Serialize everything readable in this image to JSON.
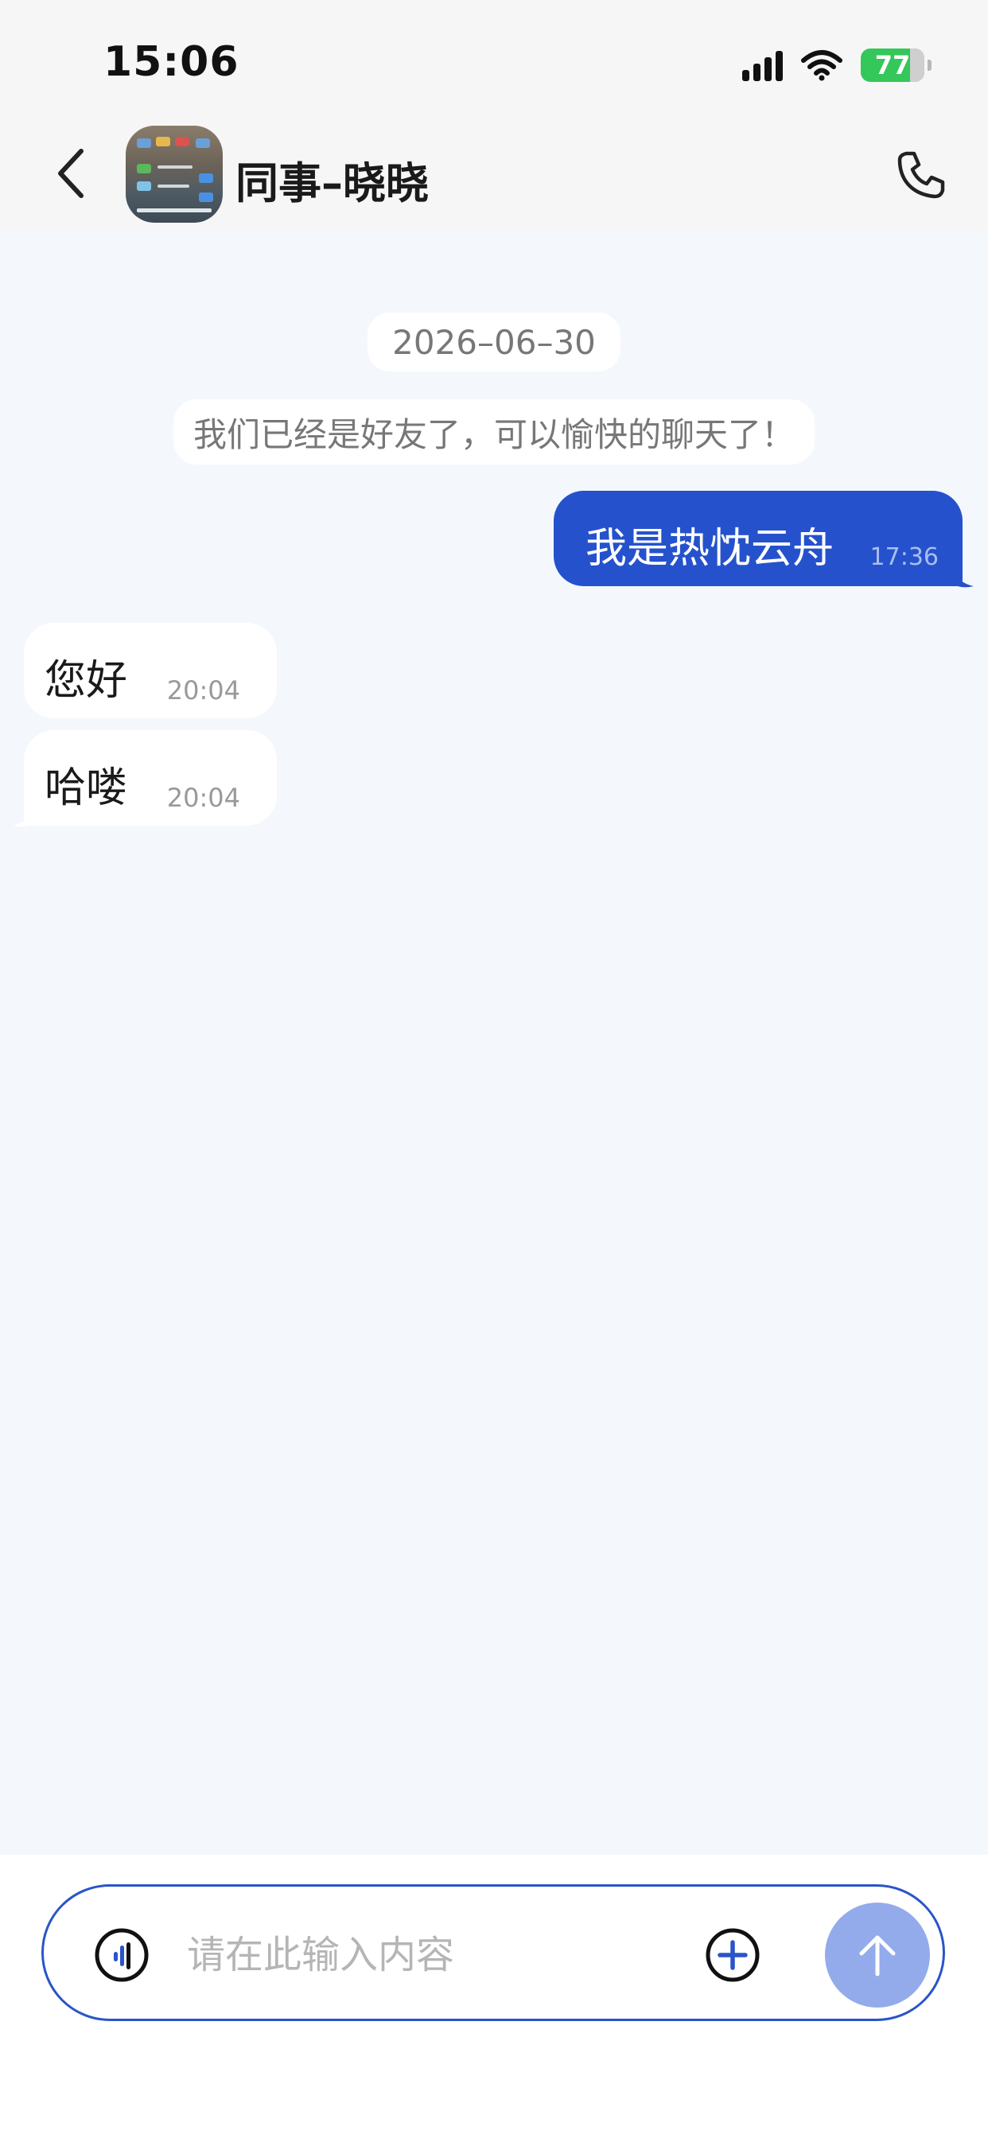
{
  "status_bar": {
    "time": "15:06",
    "battery_percent": "77",
    "battery_color": "#34c759"
  },
  "header": {
    "title": "同事–晓晓",
    "back_icon": "chevron-left-icon",
    "call_icon": "phone-icon"
  },
  "chat": {
    "date": "2026–06–30",
    "system_message": "我们已经是好友了，可以愉快的聊天了！",
    "messages": [
      {
        "direction": "outgoing",
        "text": "我是热忱云舟",
        "time": "17:36"
      },
      {
        "direction": "incoming",
        "text": "您好",
        "time": "20:04"
      },
      {
        "direction": "incoming",
        "text": "哈喽",
        "time": "20:04"
      }
    ],
    "outgoing_bubble_color": "#2552cc"
  },
  "composer": {
    "placeholder": "请在此输入内容",
    "value": "",
    "voice_icon": "voice-icon",
    "plus_icon": "plus-circle-icon",
    "send_icon": "arrow-up-icon",
    "accent_color": "#2a55c8"
  }
}
